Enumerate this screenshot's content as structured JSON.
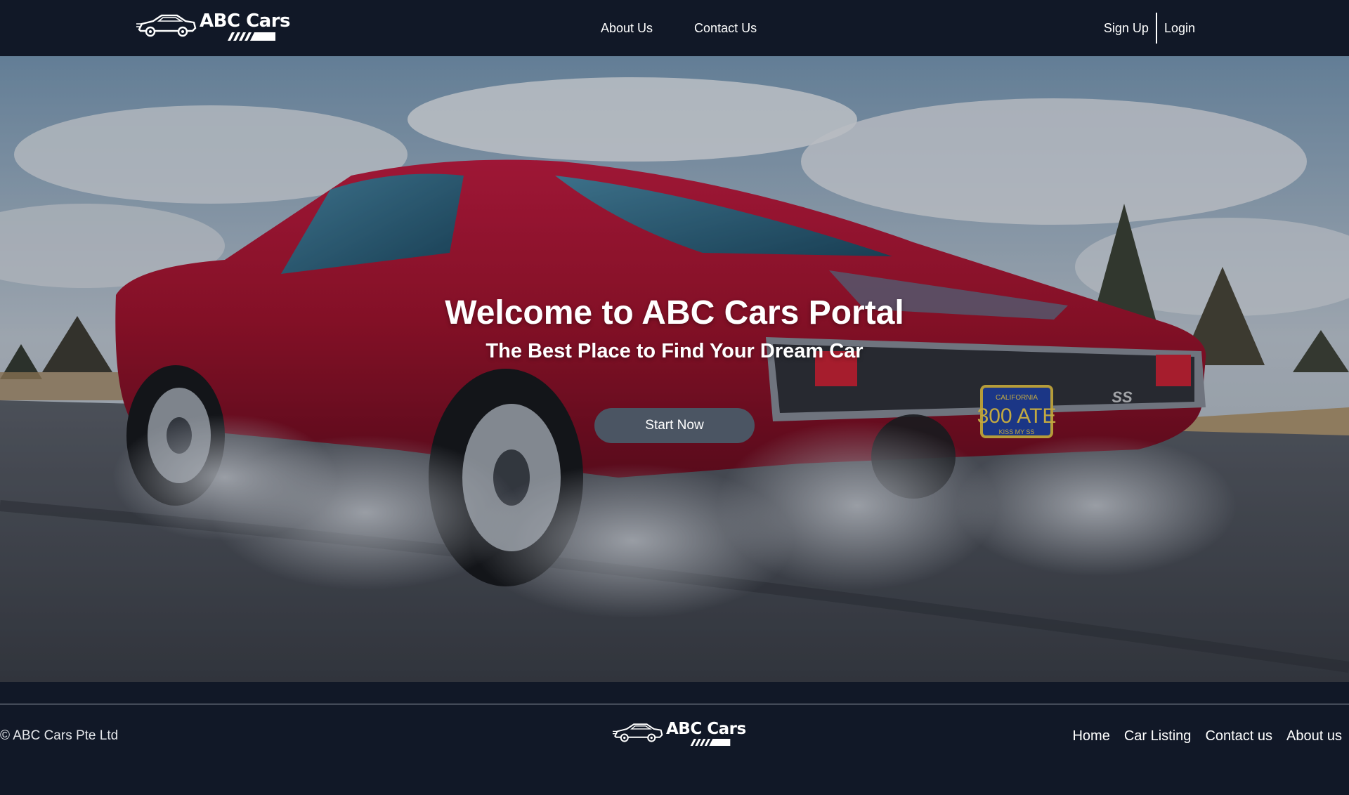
{
  "brand": {
    "name": "ABC Cars"
  },
  "nav": {
    "links": [
      "About Us",
      "Contact Us"
    ],
    "auth": {
      "signup": "Sign Up",
      "login": "Login"
    }
  },
  "hero": {
    "title": "Welcome to ABC Cars Portal",
    "subtitle": "The Best Place to Find Your Dream Car",
    "cta": "Start Now",
    "plate_top": "CALIFORNIA",
    "plate_main": "300 ATE",
    "plate_bottom": "KISS MY SS",
    "badge": "SS"
  },
  "footer": {
    "copyright": "© ABC Cars Pte Ltd",
    "links": [
      "Home",
      "Car Listing",
      "Contact us",
      "About us"
    ]
  },
  "colors": {
    "background": "#111827",
    "button": "#4b5563",
    "car_red": "#b3122a"
  }
}
